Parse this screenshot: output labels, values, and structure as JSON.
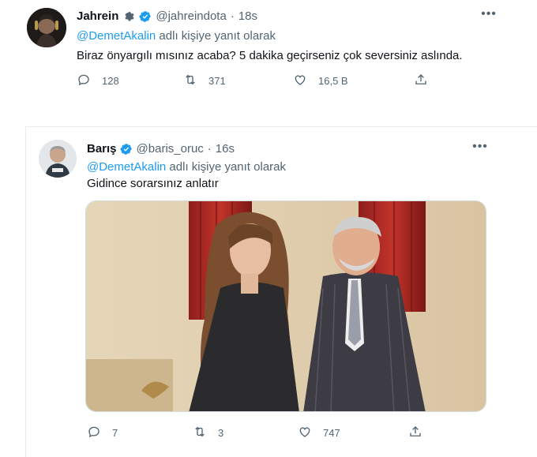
{
  "tweets": [
    {
      "author_name": "Jahrein",
      "author_handle": "@jahreindota",
      "separator": "·",
      "time": "18s",
      "reply_mention": "@DemetAkalin",
      "reply_suffix": " adlı kişiye yanıt olarak",
      "text": "Biraz önyargılı mısınız acaba? 5 dakika geçirseniz çok seversiniz aslında.",
      "more": "•••",
      "replies": "128",
      "retweets": "371",
      "likes": "16,5 B"
    },
    {
      "author_name": "Barış",
      "author_handle": "@baris_oruc",
      "separator": "·",
      "time": "16s",
      "reply_mention": "@DemetAkalin",
      "reply_suffix": " adlı kişiye yanıt olarak",
      "text": "Gidince sorarsınız anlatır",
      "more": "•••",
      "replies": "7",
      "retweets": "3",
      "likes": "747"
    }
  ],
  "colors": {
    "link": "#1d9bf0",
    "secondary": "#536471",
    "verified": "#1d9bf0"
  },
  "icons": [
    "reply-icon",
    "retweet-icon",
    "like-icon",
    "share-icon",
    "verified-badge-icon",
    "gear-icon",
    "more-icon"
  ]
}
